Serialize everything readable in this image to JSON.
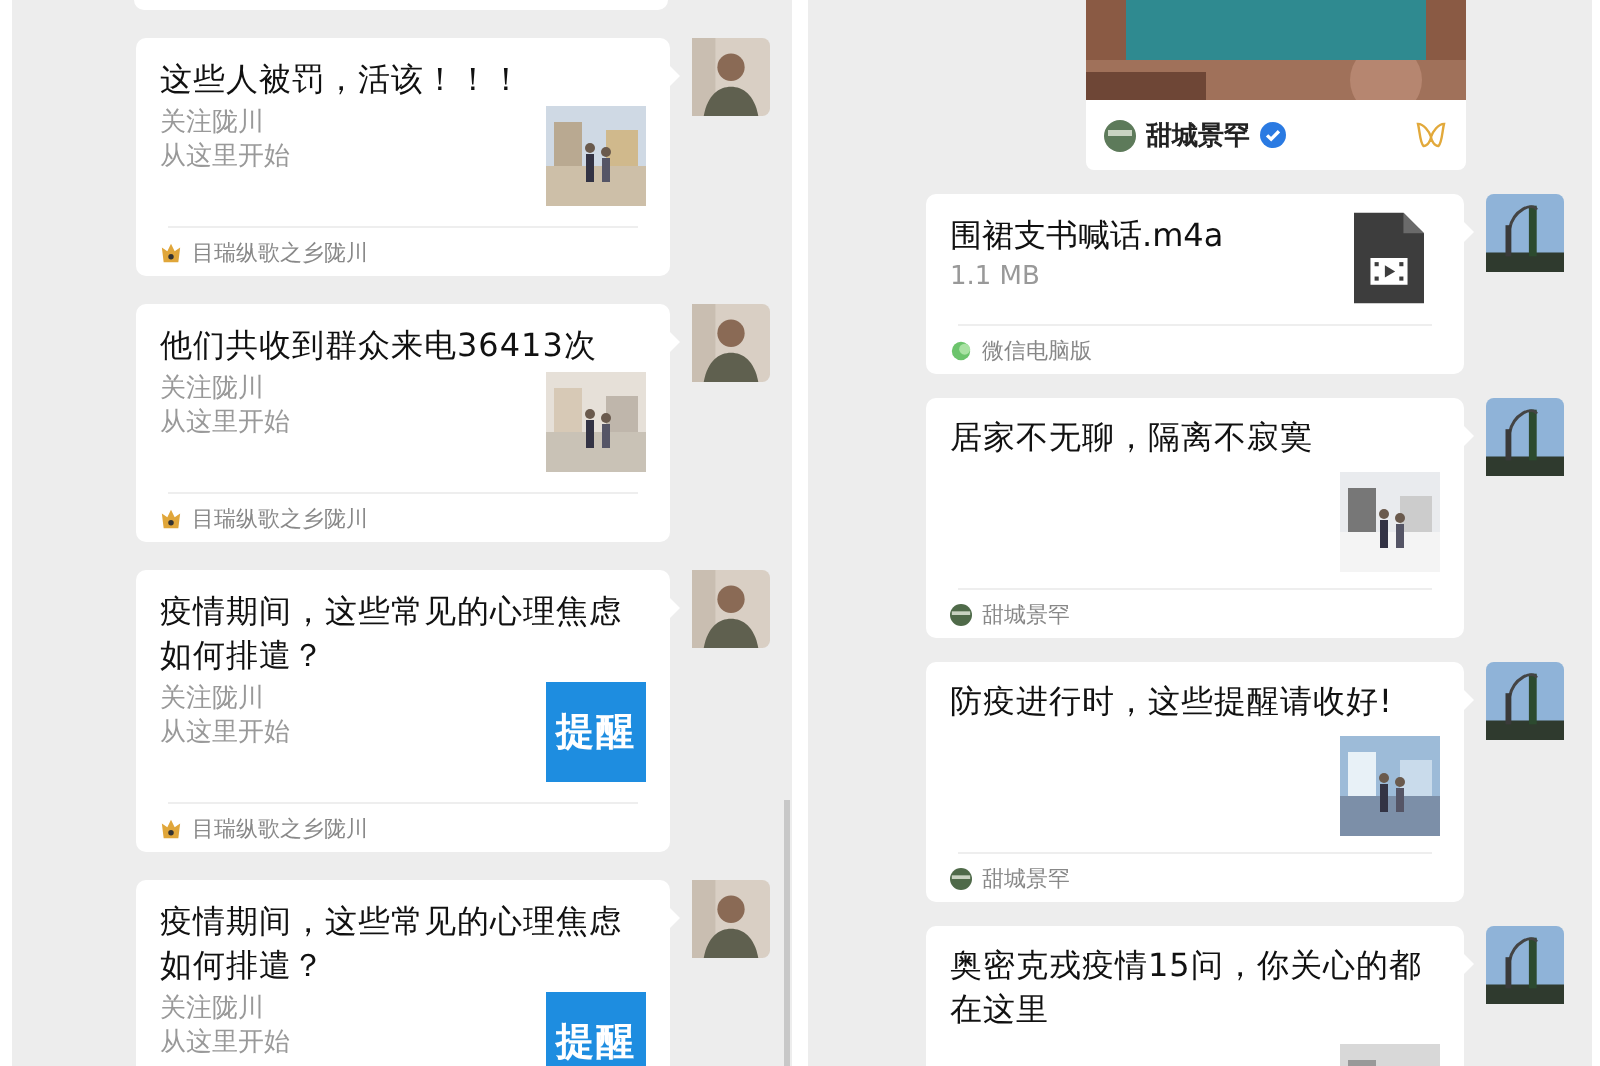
{
  "left_panel": {
    "messages": [
      {
        "kind": "article",
        "title": "这些人被罚，活该！！！",
        "lines": [
          "关注陇川",
          "从这里开始"
        ],
        "source": "目瑞纵歌之乡陇川"
      },
      {
        "kind": "article",
        "title": "他们共收到群众来电36413次",
        "lines": [
          "关注陇川",
          "从这里开始"
        ],
        "source": "目瑞纵歌之乡陇川"
      },
      {
        "kind": "article",
        "title": "疫情期间，这些常见的心理焦虑如何排遣？",
        "lines": [
          "关注陇川",
          "从这里开始"
        ],
        "thumb": {
          "kind": "text",
          "text": "提醒"
        },
        "source": "目瑞纵歌之乡陇川"
      },
      {
        "kind": "article",
        "title": "疫情期间，这些常见的心理焦虑如何排遣？",
        "lines": [
          "关注陇川",
          "从这里开始"
        ],
        "thumb": {
          "kind": "text",
          "text": "提醒"
        }
      }
    ]
  },
  "right_panel": {
    "messages": [
      {
        "kind": "video",
        "channel": "甜城景罕",
        "verified": true
      },
      {
        "kind": "file",
        "name": "围裙支书喊话.m4a",
        "size": "1.1 MB",
        "source": "微信电脑版"
      },
      {
        "kind": "article",
        "title": "居家不无聊，隔离不寂寞",
        "source": "甜城景罕"
      },
      {
        "kind": "article",
        "title": "防疫进行时，这些提醒请收好!",
        "source": "甜城景罕"
      },
      {
        "kind": "article",
        "title": "奥密克戎疫情15问，你关心的都在这里"
      }
    ]
  }
}
